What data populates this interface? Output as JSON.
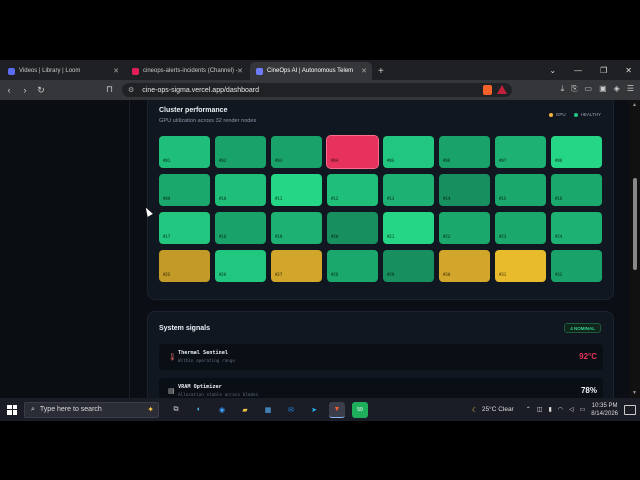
{
  "browser": {
    "tabs": [
      {
        "title": "Videos | Library | Loom",
        "color": "#5b6bf3"
      },
      {
        "title": "cineops-alerts-incidents (Channel) - ",
        "color": "#e01e5a"
      },
      {
        "title": "CineOps AI | Autonomous Telem",
        "color": "#6d7cff"
      }
    ],
    "url": "cine-ops-sigma.vercel.app/dashboard"
  },
  "performance": {
    "title": "Cluster performance",
    "subtitle": "GPU utilization across 32 render nodes",
    "legend": [
      {
        "label": "GPU",
        "color": "#f5b23b"
      },
      {
        "label": "HEALTHY",
        "color": "#22c581"
      }
    ],
    "nodes": [
      {
        "label": "#01",
        "status": "healthy",
        "color": "#1fbf7a"
      },
      {
        "label": "#02",
        "status": "healthy",
        "color": "#19a36a"
      },
      {
        "label": "#03",
        "status": "healthy",
        "color": "#19a36a"
      },
      {
        "label": "#04",
        "status": "critical",
        "color": "#e8325e"
      },
      {
        "label": "#05",
        "status": "healthy",
        "color": "#21c77f"
      },
      {
        "label": "#06",
        "status": "healthy",
        "color": "#19a36a"
      },
      {
        "label": "#07",
        "status": "healthy",
        "color": "#1db174"
      },
      {
        "label": "#08",
        "status": "healthy",
        "color": "#24d685"
      },
      {
        "label": "#09",
        "status": "healthy",
        "color": "#1aa86c"
      },
      {
        "label": "#10",
        "status": "healthy",
        "color": "#1fbf7a"
      },
      {
        "label": "#11",
        "status": "healthy",
        "color": "#24d685"
      },
      {
        "label": "#12",
        "status": "healthy",
        "color": "#1fbf7a"
      },
      {
        "label": "#13",
        "status": "healthy",
        "color": "#1db174"
      },
      {
        "label": "#14",
        "status": "healthy",
        "color": "#178f5f"
      },
      {
        "label": "#15",
        "status": "healthy",
        "color": "#1aa86c"
      },
      {
        "label": "#16",
        "status": "healthy",
        "color": "#1aa86c"
      },
      {
        "label": "#17",
        "status": "healthy",
        "color": "#21c77f"
      },
      {
        "label": "#18",
        "status": "healthy",
        "color": "#19a36a"
      },
      {
        "label": "#19",
        "status": "healthy",
        "color": "#1db174"
      },
      {
        "label": "#20",
        "status": "healthy",
        "color": "#178f5f"
      },
      {
        "label": "#21",
        "status": "healthy",
        "color": "#24d685"
      },
      {
        "label": "#22",
        "status": "healthy",
        "color": "#1aa86c"
      },
      {
        "label": "#23",
        "status": "healthy",
        "color": "#1aa86c"
      },
      {
        "label": "#24",
        "status": "healthy",
        "color": "#1db174"
      },
      {
        "label": "#25",
        "status": "warning",
        "color": "#c39a28"
      },
      {
        "label": "#26",
        "status": "healthy",
        "color": "#21c77f"
      },
      {
        "label": "#27",
        "status": "warning",
        "color": "#d2a62a"
      },
      {
        "label": "#28",
        "status": "healthy",
        "color": "#1aa86c"
      },
      {
        "label": "#29",
        "status": "healthy",
        "color": "#178f5f"
      },
      {
        "label": "#30",
        "status": "warning",
        "color": "#d2a62a"
      },
      {
        "label": "#31",
        "status": "warning",
        "color": "#e8bb2c"
      },
      {
        "label": "#32",
        "status": "healthy",
        "color": "#19a36a"
      }
    ]
  },
  "signals": {
    "title": "System signals",
    "badge": "4 NOMINAL",
    "items": [
      {
        "name": "Thermal Sentinel",
        "desc": "Within operating range",
        "value": "92°C",
        "value_color": "#e8325e",
        "icon": "thermometer-icon"
      },
      {
        "name": "VRAM Optimizer",
        "desc": "Allocation stable across blades",
        "value": "78%",
        "value_color": "#f2f4f8",
        "icon": "memory-icon"
      }
    ]
  },
  "taskbar": {
    "search_placeholder": "Type here to search",
    "weather": "25°C  Clear",
    "time": "10:35 PM",
    "date": "8/14/2026",
    "badge_count": "59"
  }
}
